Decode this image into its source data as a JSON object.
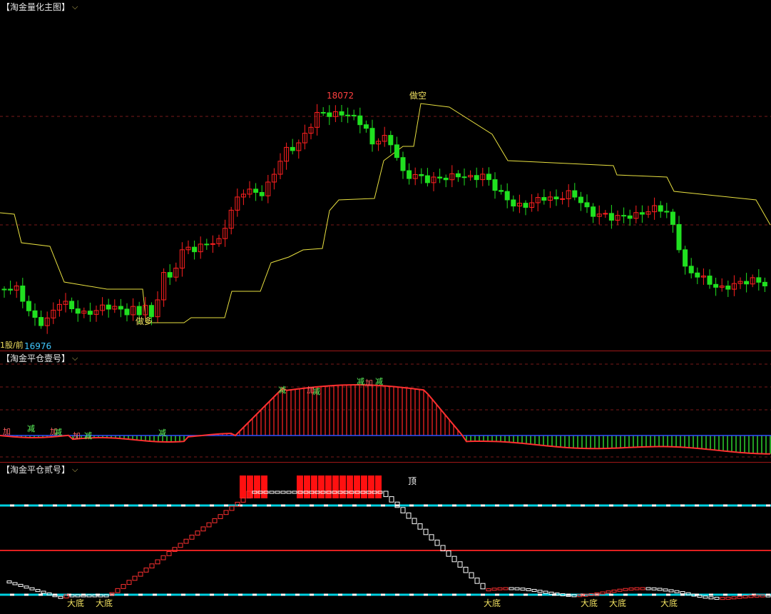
{
  "colors": {
    "up": "#ff2020",
    "down": "#20e020",
    "grid": "#7a1a1a",
    "stop_line": "#e8e040",
    "label_yellow": "#f0e060",
    "low_label": "#40c8ff",
    "high_label": "#ff4040",
    "cyan_dash": "#00d0e0",
    "red_line": "#e02020"
  },
  "icons": {
    "panel_menu": "chevron-down-icon"
  },
  "main_panel": {
    "title": "【淘金量化主图】",
    "high_label": "18072",
    "low_label": "16976",
    "low_prefix": "1股/前",
    "signal_buy": "做多",
    "signal_sell": "做空"
  },
  "panel_one": {
    "title": "【淘金平仓壹号】",
    "add_label": "加",
    "reduce_label": "减"
  },
  "panel_two": {
    "title": "【淘金平仓贰号】",
    "top_label": "顶",
    "bottom_label": "大底"
  }
}
